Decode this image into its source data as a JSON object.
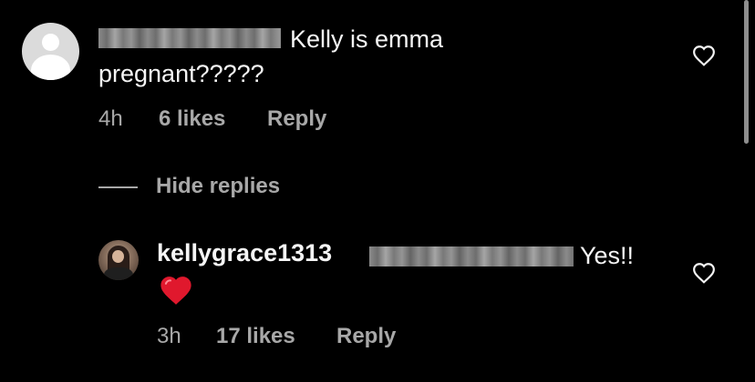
{
  "comment": {
    "text_line1": "Kelly is emma",
    "text_line2": "pregnant?????",
    "time": "4h",
    "likes": "6 likes",
    "reply": "Reply"
  },
  "hide_replies": "Hide replies",
  "reply": {
    "username": "kellygrace1313",
    "text": "Yes!!",
    "emoji": "red-heart",
    "time": "3h",
    "likes": "17 likes",
    "reply": "Reply"
  },
  "icons": {
    "like": "heart-outline-icon",
    "avatar_default": "default-avatar-icon"
  },
  "colors": {
    "background": "#000000",
    "primary_text": "#f5f5f5",
    "secondary_text": "#a8a8a8",
    "emoji_heart": "#e0182d"
  }
}
